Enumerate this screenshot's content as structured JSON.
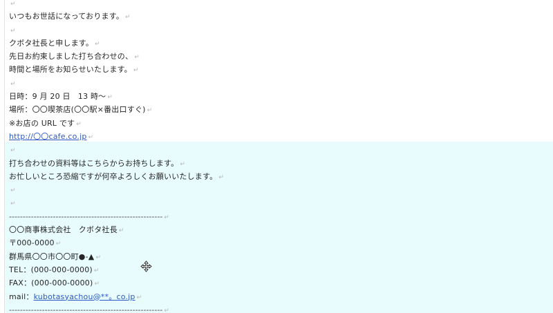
{
  "paragraph_mark": "↵",
  "lines": [
    "",
    "いつもお世話になっております。",
    "",
    "クボタ社長と申します。",
    "先日お約束しました打ち合わせの、",
    "時間と場所をお知らせいたします。",
    "",
    "日時：9 月 20 日　13 時〜",
    "場所：〇〇喫茶店(〇〇駅×番出口すぐ)",
    "※お店の URL です",
    "",
    "",
    "打ち合わせの資料等はこちらからお持ちします。",
    "お忙しいところ恐縮ですが何卒よろしくお願いいたします。",
    "",
    "",
    "--------------------------------------------------------",
    "〇〇商事株式会社　クボタ社長",
    "〒000-0000",
    "群馬県〇〇市〇〇町●-▲",
    "TEL：(000-000-0000)",
    "FAX：(000-000-0000)",
    "",
    "--------------------------------------------------------"
  ],
  "links": {
    "cafe_url": "http://〇〇cafe.co.jp",
    "mail_label": "mail：",
    "mail_address": "kubotasyachou@**。co.jp"
  },
  "colors": {
    "highlight": "#e8fbfd",
    "link": "#2b59c3"
  },
  "cursor_icon": "move-cursor-icon"
}
